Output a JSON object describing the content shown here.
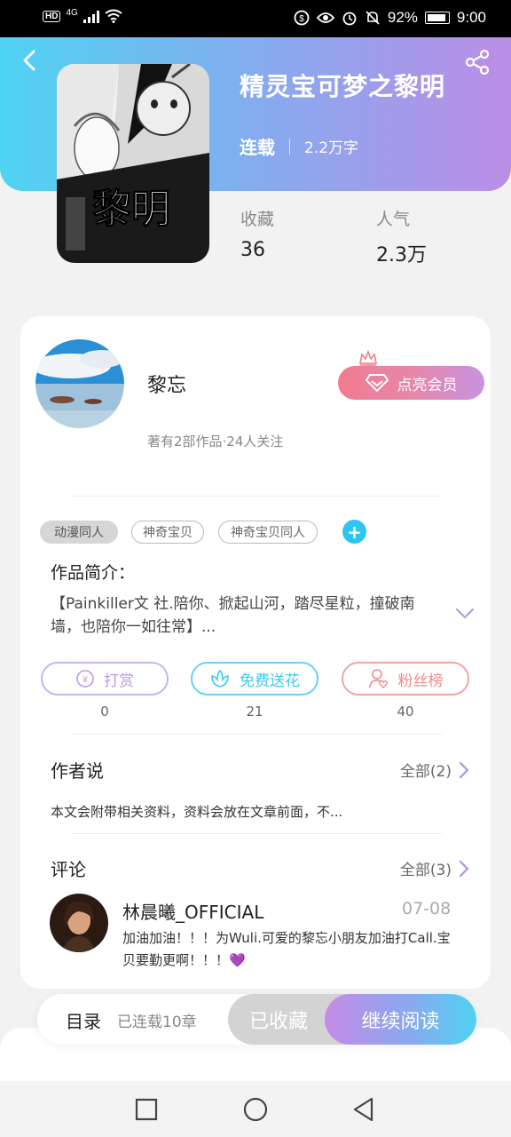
{
  "status_bar": {
    "network": "HD",
    "network_type": "4G",
    "battery": "92%",
    "time": "9:00"
  },
  "book": {
    "title": "精灵宝可梦之黎明",
    "status": "连载",
    "word_count": "2.2万字",
    "collect_label": "收藏",
    "collect_value": "36",
    "popularity_label": "人气",
    "popularity_value": "2.3万",
    "cover_text": "黎明"
  },
  "author": {
    "name": "黎忘",
    "meta": "著有2部作品·24人关注",
    "vip_button": "点亮会员"
  },
  "tags": [
    "动漫同人",
    "神奇宝贝",
    "神奇宝贝同人"
  ],
  "intro": {
    "title": "作品简介：",
    "text": "【Painkiller文 社.陪你、掀起山河，踏尽星粒，撞破南墙，也陪你一如往常】..."
  },
  "actions": [
    {
      "label": "打赏",
      "count": "0",
      "color": "#b79be6"
    },
    {
      "label": "免费送花",
      "count": "21",
      "color": "#3ccbec"
    },
    {
      "label": "粉丝榜",
      "count": "40",
      "color": "#ee8b8b"
    }
  ],
  "author_say": {
    "title": "作者说",
    "all": "全部(2)",
    "text": "本文会附带相关资料，资料会放在文章前面，不..."
  },
  "comments": {
    "title": "评论",
    "all": "全部(3)",
    "items": [
      {
        "name": "林晨曦_OFFICIAL",
        "date": "07-08",
        "text": "加油加油！！！为Wuli.可爱的黎忘小朋友加油打Call.宝贝要勤更啊！！！💜"
      }
    ]
  },
  "bottom": {
    "toc": "目录",
    "toc_sub": "已连载10章",
    "collected": "已收藏",
    "continue": "继续阅读"
  },
  "colors": {
    "accent_purple": "#bb8ee6",
    "accent_cyan": "#4fd3f2",
    "vip_pink": "#f27b8e"
  }
}
